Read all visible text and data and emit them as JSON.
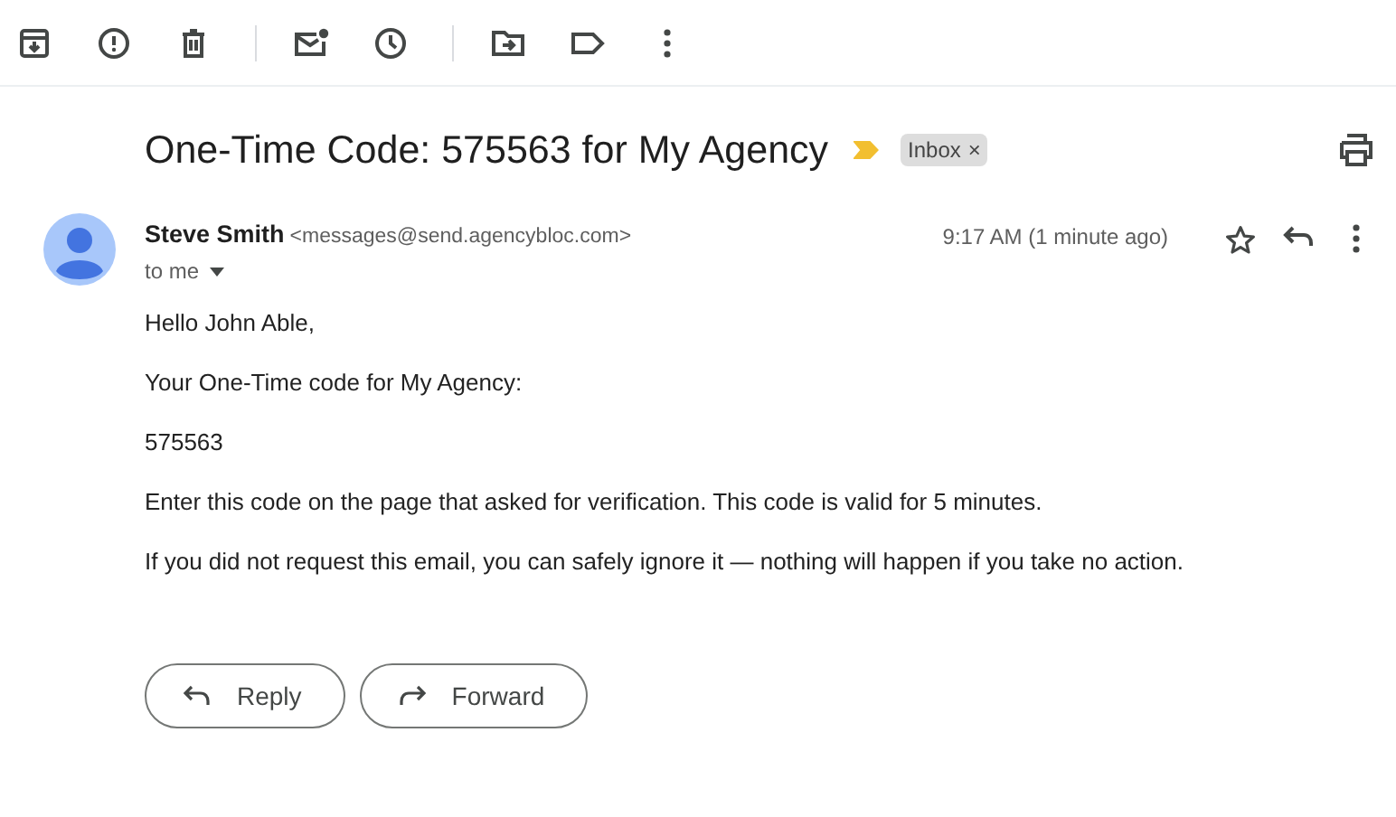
{
  "subject": {
    "title": "One-Time Code: 575563 for My Agency",
    "important": true,
    "labels": [
      {
        "name": "Inbox",
        "remove": "×"
      }
    ]
  },
  "message": {
    "sender_name": "Steve Smith",
    "sender_email": "<messages@send.agencybloc.com>",
    "recipient": "to me",
    "time": "9:17 AM (1 minute ago)",
    "starred": false,
    "body": [
      "Hello John Able,",
      "Your One-Time code for My Agency:",
      "575563",
      "Enter this code on the page that asked for verification. This code is valid for 5 minutes.",
      "If you did not request this email, you can safely ignore it — nothing will happen if you take no action."
    ]
  },
  "actions": [
    {
      "kind": "reply",
      "label": "Reply"
    },
    {
      "kind": "forward",
      "label": "Forward"
    }
  ]
}
